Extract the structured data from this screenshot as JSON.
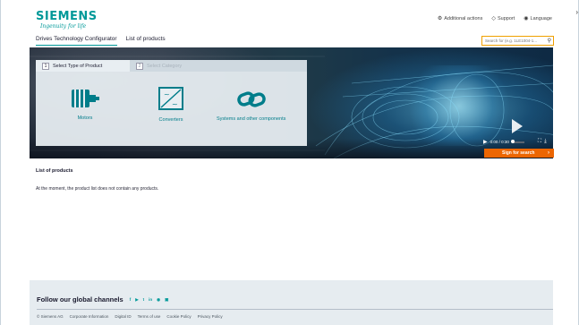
{
  "header": {
    "brand": "SIEMENS",
    "tagline": "Ingenuity for life",
    "top_links": [
      {
        "label": "Additional actions",
        "icon": "gear-icon"
      },
      {
        "label": "Support",
        "icon": "support-icon"
      },
      {
        "label": "Language",
        "icon": "globe-icon"
      }
    ],
    "nav_tabs": [
      {
        "label": "Drives Technology Configurator",
        "active": true
      },
      {
        "label": "List of products",
        "active": false
      }
    ],
    "search": {
      "placeholder": "Search for (e.g. 1LE1004-1...",
      "icon": "search-icon"
    }
  },
  "hero": {
    "steps": [
      {
        "number": "1",
        "label": "Select Type of Product",
        "active": true
      },
      {
        "number": "2",
        "label": "Select Category",
        "active": false
      }
    ],
    "options": [
      {
        "label": "Motors",
        "icon": "motor-icon"
      },
      {
        "label": "Converters",
        "icon": "converter-icon"
      },
      {
        "label": "Systems and other components",
        "icon": "link-icon"
      }
    ],
    "player": {
      "time": "0:00 / 0:30"
    },
    "signup": {
      "label": "Sign for search"
    }
  },
  "main": {
    "title": "List of products",
    "empty_message": "At the moment, the product list does not contain any products."
  },
  "footer": {
    "follow_label": "Follow our global channels",
    "social": [
      "f",
      "▶",
      "t",
      "in",
      "◉",
      "▣"
    ],
    "links": [
      "© Siemens AG",
      "Corporate Information",
      "Digital ID",
      "Terms of use",
      "Cookie Policy",
      "Privacy Policy"
    ]
  },
  "colors": {
    "brand": "#009999",
    "accent": "#ec6602",
    "search_border": "#f0a000"
  }
}
